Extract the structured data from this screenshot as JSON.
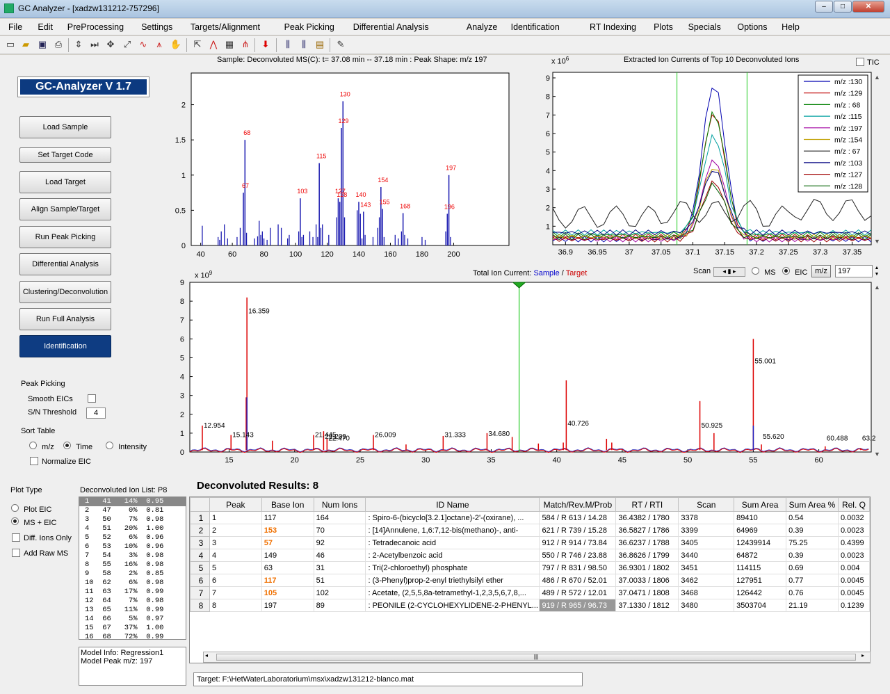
{
  "window": {
    "title": "GC Analyzer - [xadzw131212-757296]"
  },
  "menu": [
    "File",
    "Edit",
    "PreProcessing",
    "Settings",
    "Targets/Alignment",
    "Peak Picking",
    "Differential Analysis",
    "Analyze",
    "Identification",
    "RT Indexing",
    "Plots",
    "Specials",
    "Options",
    "Help"
  ],
  "version": "GC-Analyzer V 1.7",
  "buttons": {
    "load_sample": "Load Sample",
    "set_target_code": "Set Target Code",
    "load_target": "Load Target",
    "align": "Align Sample/Target",
    "run_peak_picking": "Run Peak Picking",
    "diff_analysis": "Differential Analysis",
    "clustering": "Clustering/Deconvolution",
    "run_full": "Run Full Analysis",
    "identification": "Identification"
  },
  "peak_picking": {
    "heading": "Peak Picking",
    "smooth_label": "Smooth EICs",
    "sn_label": "S/N Threshold",
    "sn_value": "4"
  },
  "sort_table": {
    "heading": "Sort Table",
    "mz": "m/z",
    "time": "Time",
    "intensity": "Intensity",
    "normalize": "Normalize EIC",
    "selected": "Time"
  },
  "plot_type": {
    "heading": "Plot Type",
    "plot_eic": "Plot EIC",
    "ms_eic": "MS + EIC",
    "diff_ions": "Diff. Ions Only",
    "add_raw": "Add Raw MS"
  },
  "ion_list": {
    "heading": "Deconvoluted Ion List: P8",
    "rows": [
      "1   41   14%  0.95",
      "2   47    0%  0.81",
      "3   50    7%  0.98",
      "4   51   20%  1.00",
      "5   52    6%  0.96",
      "6   53   10%  0.96",
      "7   54    3%  0.98",
      "8   55   16%  0.98",
      "9   58    2%  0.85",
      "10  62    6%  0.98",
      "11  63   17%  0.99",
      "12  64    7%  0.98",
      "13  65   11%  0.99",
      "14  66    5%  0.97",
      "15  67   37%  1.00",
      "16  68   72%  0.99"
    ]
  },
  "model_info": {
    "line1": "Model Info: Regression1",
    "line2": "Model Peak m/z: 197"
  },
  "ms_plot": {
    "title": "Sample: Deconvoluted MS(C): t= 37.08 min -- 37.18 min : Peak Shape: m/z  197",
    "yticks": [
      "0",
      "0.5",
      "1",
      "1.5",
      "2"
    ],
    "xticks": [
      "40",
      "60",
      "80",
      "100",
      "120",
      "140",
      "160",
      "180",
      "200"
    ],
    "labels": [
      {
        "t": "130",
        "x": 130,
        "y": 2.1
      },
      {
        "t": "129",
        "x": 129,
        "y": 1.72
      },
      {
        "t": "68",
        "x": 68,
        "y": 1.55
      },
      {
        "t": "115",
        "x": 115,
        "y": 1.22
      },
      {
        "t": "197",
        "x": 197,
        "y": 1.05
      },
      {
        "t": "154",
        "x": 154,
        "y": 0.88
      },
      {
        "t": "67",
        "x": 67,
        "y": 0.8
      },
      {
        "t": "103",
        "x": 103,
        "y": 0.72
      },
      {
        "t": "127",
        "x": 127,
        "y": 0.72
      },
      {
        "t": "128",
        "x": 128,
        "y": 0.67
      },
      {
        "t": "140",
        "x": 140,
        "y": 0.67
      },
      {
        "t": "143",
        "x": 143,
        "y": 0.53
      },
      {
        "t": "155",
        "x": 155,
        "y": 0.57
      },
      {
        "t": "168",
        "x": 168,
        "y": 0.51
      },
      {
        "t": "196",
        "x": 196,
        "y": 0.5
      }
    ]
  },
  "eic_plot": {
    "title": "Extracted Ion Currents of Top 10 Deconvoluted Ions",
    "exp": "x 10",
    "exp_sup": "6",
    "tic_label": "TIC",
    "yticks": [
      "1",
      "2",
      "3",
      "4",
      "5",
      "6",
      "7",
      "8",
      "9"
    ],
    "xticks": [
      "36.9",
      "36.95",
      "37",
      "37.05",
      "37.1",
      "37.15",
      "37.2",
      "37.25",
      "37.3",
      "37.35"
    ],
    "legend": [
      {
        "l": "m/z :130",
        "c": "#0000b0"
      },
      {
        "l": "m/z :129",
        "c": "#c00000"
      },
      {
        "l": "m/z : 68",
        "c": "#008000"
      },
      {
        "l": "m/z :115",
        "c": "#00a0a0"
      },
      {
        "l": "m/z :197",
        "c": "#a000a0"
      },
      {
        "l": "m/z :154",
        "c": "#c0a000"
      },
      {
        "l": "m/z : 67",
        "c": "#202020"
      },
      {
        "l": "m/z :103",
        "c": "#000080"
      },
      {
        "l": "m/z :127",
        "c": "#a00000"
      },
      {
        "l": "m/z :128",
        "c": "#006000"
      }
    ],
    "peaks": [
      8.4,
      6.7,
      6.6,
      5.2,
      4.3,
      3.8,
      1.7,
      3.4,
      3.1,
      2.8
    ]
  },
  "tic_plot": {
    "title_prefix": "Total Ion Current: ",
    "sample": "Sample",
    "sep": " / ",
    "target": "Target",
    "exp": "x 10",
    "exp_sup": "9",
    "yticks": [
      "0",
      "1",
      "2",
      "3",
      "4",
      "5",
      "6",
      "7",
      "8",
      "9"
    ],
    "xticks": [
      "15",
      "20",
      "25",
      "30",
      "35",
      "40",
      "45",
      "50",
      "55",
      "60"
    ],
    "labels": [
      {
        "t": "12.954",
        "x": 12.954,
        "y": 1.3
      },
      {
        "t": "15.143",
        "x": 15.143,
        "y": 0.8
      },
      {
        "t": "16.359",
        "x": 16.359,
        "y": 7.35
      },
      {
        "t": "21.445",
        "x": 21.445,
        "y": 0.8
      },
      {
        "t": "22.209",
        "x": 22.209,
        "y": 0.7
      },
      {
        "t": "22.470",
        "x": 22.47,
        "y": 0.6
      },
      {
        "t": "26.009",
        "x": 26.009,
        "y": 0.8
      },
      {
        "t": "31.333",
        "x": 31.333,
        "y": 0.8
      },
      {
        "t": "34.680",
        "x": 34.68,
        "y": 0.85
      },
      {
        "t": "40.726",
        "x": 40.726,
        "y": 1.4
      },
      {
        "t": "50.925",
        "x": 50.925,
        "y": 1.3
      },
      {
        "t": "55.001",
        "x": 55.001,
        "y": 4.7
      },
      {
        "t": "55.620",
        "x": 55.62,
        "y": 0.7
      },
      {
        "t": "60.488",
        "x": 60.488,
        "y": 0.6
      },
      {
        "t": "63.2",
        "x": 63.2,
        "y": 0.6
      }
    ]
  },
  "scan_controls": {
    "scan": "Scan",
    "ms": "MS",
    "eic": "EIC",
    "mz_btn": "m/z",
    "mz_value": "197"
  },
  "results": {
    "title": "Deconvoluted Results: 8",
    "columns": [
      "Peak",
      "Base Ion",
      "Num Ions",
      "ID Name",
      "Match/Rev.M/Prob",
      "RT / RTI",
      "Scan",
      "Sum Area",
      "Sum Area %",
      "Rel. Q"
    ],
    "rows": [
      {
        "n": "1",
        "peak": "1",
        "base": "117",
        "num": "164",
        "name": ": Spiro-6-(bicyclo[3.2.1]octane)-2'-(oxirane), ...",
        "match": "584 / R 613 /  14.28",
        "rt": "36.4382 / 1780",
        "scan": "3378",
        "area": "89410",
        "pct": "0.54",
        "rel": "0.0032"
      },
      {
        "n": "2",
        "peak": "2",
        "base": "153",
        "num": "70",
        "name": ": [14]Annulene, 1,6:7,12-bis(methano)-, anti-",
        "match": "621 / R 739 /  15.28",
        "rt": "36.5827 / 1786",
        "scan": "3399",
        "area": "64969",
        "pct": "0.39",
        "rel": "0.0023"
      },
      {
        "n": "3",
        "peak": "3",
        "base": "57",
        "num": "92",
        "name": ": Tetradecanoic acid",
        "match": "912 / R 914 /  73.84",
        "rt": "36.6237 / 1788",
        "scan": "3405",
        "area": "12439914",
        "pct": "75.25",
        "rel": "0.4399"
      },
      {
        "n": "4",
        "peak": "4",
        "base": "149",
        "num": "46",
        "name": ": 2-Acetylbenzoic acid",
        "match": "550 / R 746 /  23.88",
        "rt": "36.8626 / 1799",
        "scan": "3440",
        "area": "64872",
        "pct": "0.39",
        "rel": "0.0023"
      },
      {
        "n": "5",
        "peak": "5",
        "base": "63",
        "num": "31",
        "name": ": Tri(2-chloroethyl) phosphate",
        "match": "797 / R 831 /  98.50",
        "rt": "36.9301 / 1802",
        "scan": "3451",
        "area": "114115",
        "pct": "0.69",
        "rel": "0.004"
      },
      {
        "n": "6",
        "peak": "6",
        "base": "117",
        "num": "51",
        "name": ": (3-Phenyl)prop-2-enyl triethylsilyl ether",
        "match": "486 / R 670 /  52.01",
        "rt": "37.0033 / 1806",
        "scan": "3462",
        "area": "127951",
        "pct": "0.77",
        "rel": "0.0045"
      },
      {
        "n": "7",
        "peak": "7",
        "base": "105",
        "num": "102",
        "name": ": Acetate, (2,5,5,8a-tetramethyl-1,2,3,5,6,7,8,...",
        "match": "489 / R 572 /  12.01",
        "rt": "37.0471 / 1808",
        "scan": "3468",
        "area": "126442",
        "pct": "0.76",
        "rel": "0.0045"
      },
      {
        "n": "8",
        "peak": "8",
        "base": "197",
        "num": "89",
        "name": ": PEONILE (2-CYCLOHEXYLIDENE-2-PHENYL...",
        "match": "919 / R 965 /  96.73",
        "rt": "37.1330 / 1812",
        "scan": "3480",
        "area": "3503704",
        "pct": "21.19",
        "rel": "0.1239"
      }
    ]
  },
  "status": "Target: F:\\HetWaterLaboratorium\\msx\\xadzw131212-blanco.mat"
}
